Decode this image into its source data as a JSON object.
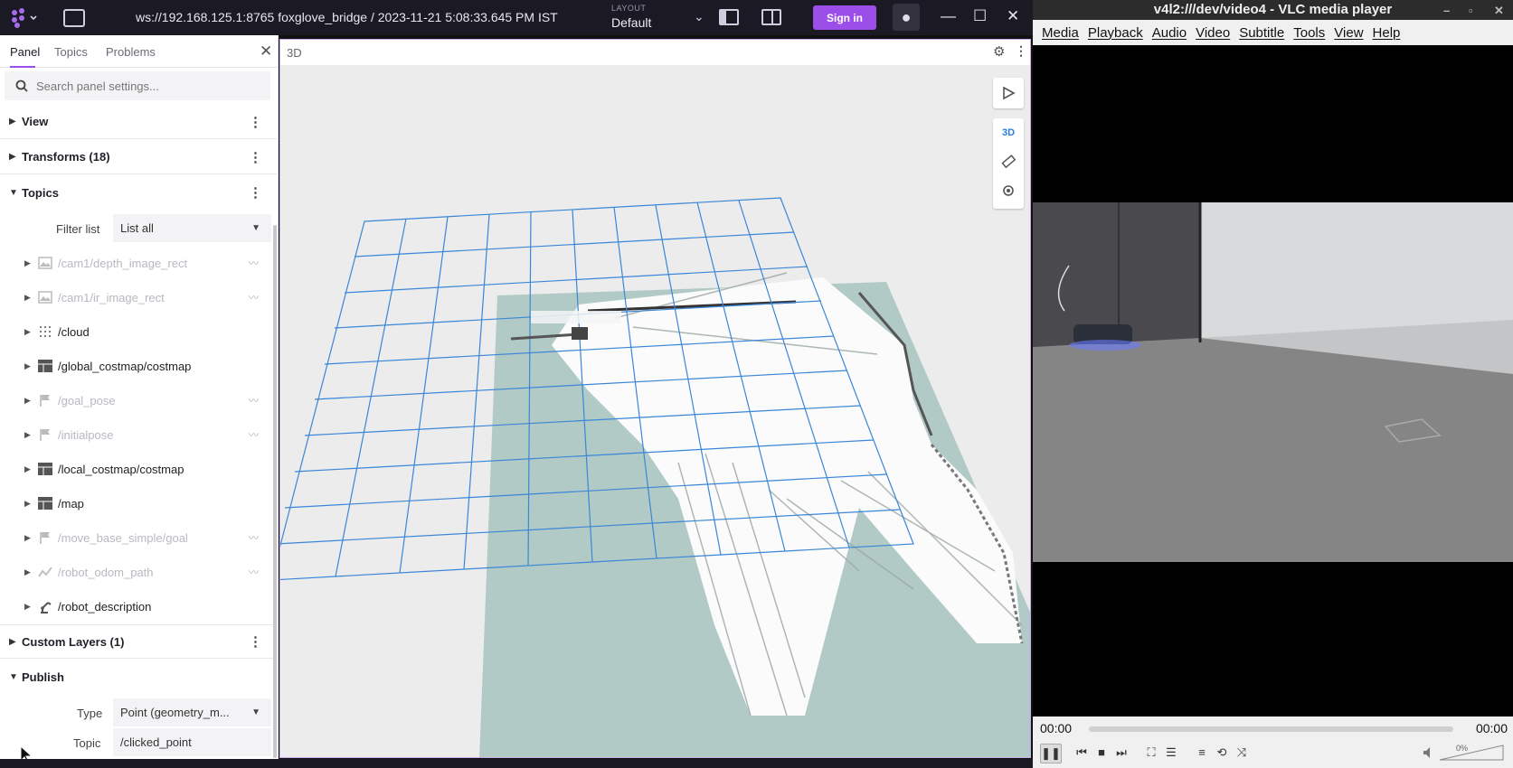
{
  "foxglove": {
    "connection": "ws://192.168.125.1:8765 foxglove_bridge / 2023-11-21 5:08:33.645 PM IST",
    "layout_caption": "LAYOUT",
    "layout_value": "Default",
    "sign_in": "Sign in",
    "accent": "#9c4fe8"
  },
  "left_panel": {
    "tabs": [
      "Panel",
      "Topics",
      "Problems"
    ],
    "search_placeholder": "Search panel settings...",
    "sections": {
      "view": "View",
      "transforms": "Transforms (18)",
      "topics": "Topics",
      "custom_layers": "Custom Layers (1)",
      "publish": "Publish"
    },
    "filter_label": "Filter list",
    "filter_value": "List all",
    "topics": [
      {
        "name": "/cam1/depth_image_rect",
        "icon": "image-icon",
        "visible": false
      },
      {
        "name": "/cam1/ir_image_rect",
        "icon": "image-icon",
        "visible": false
      },
      {
        "name": "/cloud",
        "icon": "pointcloud-icon",
        "visible": true
      },
      {
        "name": "/global_costmap/costmap",
        "icon": "grid-icon",
        "visible": true
      },
      {
        "name": "/goal_pose",
        "icon": "flag-icon",
        "visible": false
      },
      {
        "name": "/initialpose",
        "icon": "flag-icon",
        "visible": false
      },
      {
        "name": "/local_costmap/costmap",
        "icon": "grid-icon",
        "visible": true
      },
      {
        "name": "/map",
        "icon": "grid-icon",
        "visible": true
      },
      {
        "name": "/move_base_simple/goal",
        "icon": "flag-icon",
        "visible": false
      },
      {
        "name": "/robot_odom_path",
        "icon": "path-icon",
        "visible": false
      },
      {
        "name": "/robot_description",
        "icon": "robot-arm-icon",
        "visible": true
      }
    ],
    "publish": {
      "type_label": "Type",
      "type_value": "Point (geometry_m...",
      "topic_label": "Topic",
      "topic_value": "/clicked_point"
    }
  },
  "panel_3d": {
    "title": "3D",
    "mode_3d": "3D"
  },
  "vlc": {
    "title": "v4l2:///dev/video4 - VLC media player",
    "menu": [
      "Media",
      "Playback",
      "Audio",
      "Video",
      "Subtitle",
      "Tools",
      "View",
      "Help"
    ],
    "time_elapsed": "00:00",
    "time_total": "00:00",
    "volume": "0%"
  }
}
